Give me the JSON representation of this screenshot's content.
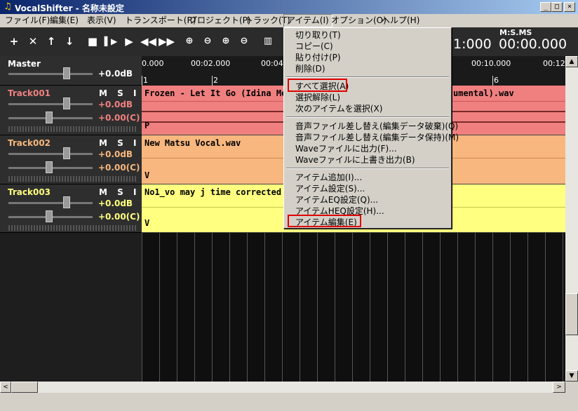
{
  "window": {
    "title": "VocalShifter - 名称未設定",
    "buttons": [
      "_",
      "□",
      "×"
    ]
  },
  "menubar": [
    "ファイル(F)",
    "編集(E)",
    "表示(V)",
    "トランスポート(R)",
    "プロジェクト(P)",
    "トラック(T)",
    "アイテム(I)",
    "オプション(O)",
    "ヘルプ(H)"
  ],
  "toolbar": {
    "time_label": "M:S.MS",
    "time_value": "00:00.000",
    "partial_time_value": "1:000"
  },
  "ruler": {
    "labels": [
      "0.000",
      "00:02.000",
      "00:04",
      "00:10.000",
      "00:12"
    ],
    "bars": [
      "1",
      "2",
      "6"
    ]
  },
  "master": {
    "name": "Master",
    "gain": "+0.0dB"
  },
  "tracks": [
    {
      "name": "Track001",
      "msi": "M S I",
      "gain": "+0.0dB",
      "pan": "+0.00(C)",
      "clip": "Frozen - Let It Go (Idina Menz",
      "clip_suffix": "umental).wav",
      "letter": "P",
      "color": "#f08080"
    },
    {
      "name": "Track002",
      "msi": "M S I",
      "gain": "+0.0dB",
      "pan": "+0.00(C)",
      "clip": "New Matsu Vocal.wav",
      "letter": "V",
      "color": "#f7b77e"
    },
    {
      "name": "Track003",
      "msi": "M S I",
      "gain": "+0.0dB",
      "pan": "+0.00(C)",
      "clip": "No1_vo may j time corrected a",
      "letter": "V",
      "color": "#ffff80"
    }
  ],
  "item_menu": {
    "group1": [
      "切り取り(T)",
      "コピー(C)",
      "貼り付け(P)",
      "削除(D)"
    ],
    "group2": [
      "すべて選択(A)",
      "選択解除(L)",
      "次のアイテムを選択(X)"
    ],
    "group3": [
      "音声ファイル差し替え(編集データ破棄)(Q)",
      "音声ファイル差し替え(編集データ保持)(M)",
      "Waveファイルに出力(F)...",
      "Waveファイルに上書き出力(B)"
    ],
    "group4": [
      "アイテム追加(I)...",
      "アイテム設定(S)...",
      "アイテムEQ設定(Q)...",
      "アイテムHEQ設定(H)...",
      "アイテム編集(E)"
    ],
    "highlight_color": "#e00000"
  },
  "scroll": {
    "left_arrow": "<",
    "right_arrow": ">",
    "up_arrow": "▲",
    "down_arrow": "▼"
  }
}
